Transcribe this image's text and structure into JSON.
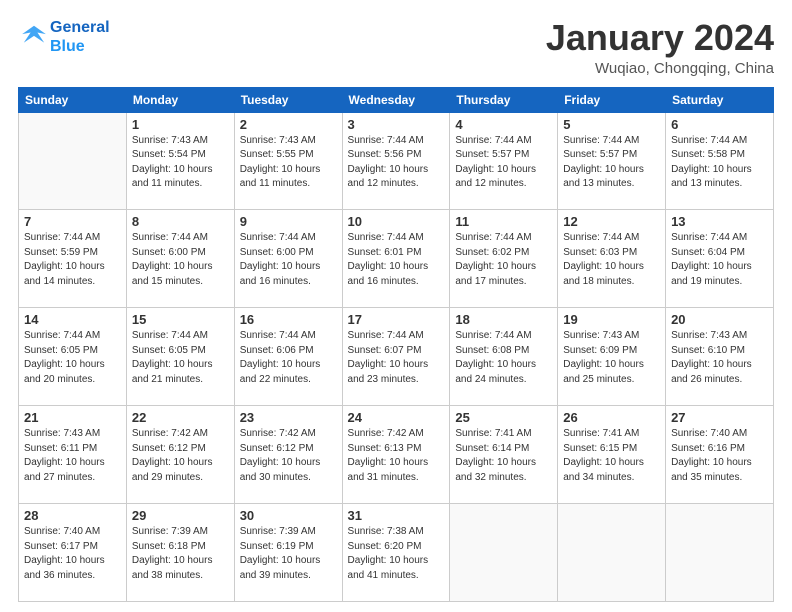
{
  "header": {
    "logo_line1": "General",
    "logo_line2": "Blue",
    "title": "January 2024",
    "location": "Wuqiao, Chongqing, China"
  },
  "weekdays": [
    "Sunday",
    "Monday",
    "Tuesday",
    "Wednesday",
    "Thursday",
    "Friday",
    "Saturday"
  ],
  "weeks": [
    [
      {
        "day": "",
        "sunrise": "",
        "sunset": "",
        "daylight": ""
      },
      {
        "day": "1",
        "sunrise": "Sunrise: 7:43 AM",
        "sunset": "Sunset: 5:54 PM",
        "daylight": "Daylight: 10 hours and 11 minutes."
      },
      {
        "day": "2",
        "sunrise": "Sunrise: 7:43 AM",
        "sunset": "Sunset: 5:55 PM",
        "daylight": "Daylight: 10 hours and 11 minutes."
      },
      {
        "day": "3",
        "sunrise": "Sunrise: 7:44 AM",
        "sunset": "Sunset: 5:56 PM",
        "daylight": "Daylight: 10 hours and 12 minutes."
      },
      {
        "day": "4",
        "sunrise": "Sunrise: 7:44 AM",
        "sunset": "Sunset: 5:57 PM",
        "daylight": "Daylight: 10 hours and 12 minutes."
      },
      {
        "day": "5",
        "sunrise": "Sunrise: 7:44 AM",
        "sunset": "Sunset: 5:57 PM",
        "daylight": "Daylight: 10 hours and 13 minutes."
      },
      {
        "day": "6",
        "sunrise": "Sunrise: 7:44 AM",
        "sunset": "Sunset: 5:58 PM",
        "daylight": "Daylight: 10 hours and 13 minutes."
      }
    ],
    [
      {
        "day": "7",
        "sunrise": "Sunrise: 7:44 AM",
        "sunset": "Sunset: 5:59 PM",
        "daylight": "Daylight: 10 hours and 14 minutes."
      },
      {
        "day": "8",
        "sunrise": "Sunrise: 7:44 AM",
        "sunset": "Sunset: 6:00 PM",
        "daylight": "Daylight: 10 hours and 15 minutes."
      },
      {
        "day": "9",
        "sunrise": "Sunrise: 7:44 AM",
        "sunset": "Sunset: 6:00 PM",
        "daylight": "Daylight: 10 hours and 16 minutes."
      },
      {
        "day": "10",
        "sunrise": "Sunrise: 7:44 AM",
        "sunset": "Sunset: 6:01 PM",
        "daylight": "Daylight: 10 hours and 16 minutes."
      },
      {
        "day": "11",
        "sunrise": "Sunrise: 7:44 AM",
        "sunset": "Sunset: 6:02 PM",
        "daylight": "Daylight: 10 hours and 17 minutes."
      },
      {
        "day": "12",
        "sunrise": "Sunrise: 7:44 AM",
        "sunset": "Sunset: 6:03 PM",
        "daylight": "Daylight: 10 hours and 18 minutes."
      },
      {
        "day": "13",
        "sunrise": "Sunrise: 7:44 AM",
        "sunset": "Sunset: 6:04 PM",
        "daylight": "Daylight: 10 hours and 19 minutes."
      }
    ],
    [
      {
        "day": "14",
        "sunrise": "Sunrise: 7:44 AM",
        "sunset": "Sunset: 6:05 PM",
        "daylight": "Daylight: 10 hours and 20 minutes."
      },
      {
        "day": "15",
        "sunrise": "Sunrise: 7:44 AM",
        "sunset": "Sunset: 6:05 PM",
        "daylight": "Daylight: 10 hours and 21 minutes."
      },
      {
        "day": "16",
        "sunrise": "Sunrise: 7:44 AM",
        "sunset": "Sunset: 6:06 PM",
        "daylight": "Daylight: 10 hours and 22 minutes."
      },
      {
        "day": "17",
        "sunrise": "Sunrise: 7:44 AM",
        "sunset": "Sunset: 6:07 PM",
        "daylight": "Daylight: 10 hours and 23 minutes."
      },
      {
        "day": "18",
        "sunrise": "Sunrise: 7:44 AM",
        "sunset": "Sunset: 6:08 PM",
        "daylight": "Daylight: 10 hours and 24 minutes."
      },
      {
        "day": "19",
        "sunrise": "Sunrise: 7:43 AM",
        "sunset": "Sunset: 6:09 PM",
        "daylight": "Daylight: 10 hours and 25 minutes."
      },
      {
        "day": "20",
        "sunrise": "Sunrise: 7:43 AM",
        "sunset": "Sunset: 6:10 PM",
        "daylight": "Daylight: 10 hours and 26 minutes."
      }
    ],
    [
      {
        "day": "21",
        "sunrise": "Sunrise: 7:43 AM",
        "sunset": "Sunset: 6:11 PM",
        "daylight": "Daylight: 10 hours and 27 minutes."
      },
      {
        "day": "22",
        "sunrise": "Sunrise: 7:42 AM",
        "sunset": "Sunset: 6:12 PM",
        "daylight": "Daylight: 10 hours and 29 minutes."
      },
      {
        "day": "23",
        "sunrise": "Sunrise: 7:42 AM",
        "sunset": "Sunset: 6:12 PM",
        "daylight": "Daylight: 10 hours and 30 minutes."
      },
      {
        "day": "24",
        "sunrise": "Sunrise: 7:42 AM",
        "sunset": "Sunset: 6:13 PM",
        "daylight": "Daylight: 10 hours and 31 minutes."
      },
      {
        "day": "25",
        "sunrise": "Sunrise: 7:41 AM",
        "sunset": "Sunset: 6:14 PM",
        "daylight": "Daylight: 10 hours and 32 minutes."
      },
      {
        "day": "26",
        "sunrise": "Sunrise: 7:41 AM",
        "sunset": "Sunset: 6:15 PM",
        "daylight": "Daylight: 10 hours and 34 minutes."
      },
      {
        "day": "27",
        "sunrise": "Sunrise: 7:40 AM",
        "sunset": "Sunset: 6:16 PM",
        "daylight": "Daylight: 10 hours and 35 minutes."
      }
    ],
    [
      {
        "day": "28",
        "sunrise": "Sunrise: 7:40 AM",
        "sunset": "Sunset: 6:17 PM",
        "daylight": "Daylight: 10 hours and 36 minutes."
      },
      {
        "day": "29",
        "sunrise": "Sunrise: 7:39 AM",
        "sunset": "Sunset: 6:18 PM",
        "daylight": "Daylight: 10 hours and 38 minutes."
      },
      {
        "day": "30",
        "sunrise": "Sunrise: 7:39 AM",
        "sunset": "Sunset: 6:19 PM",
        "daylight": "Daylight: 10 hours and 39 minutes."
      },
      {
        "day": "31",
        "sunrise": "Sunrise: 7:38 AM",
        "sunset": "Sunset: 6:20 PM",
        "daylight": "Daylight: 10 hours and 41 minutes."
      },
      {
        "day": "",
        "sunrise": "",
        "sunset": "",
        "daylight": ""
      },
      {
        "day": "",
        "sunrise": "",
        "sunset": "",
        "daylight": ""
      },
      {
        "day": "",
        "sunrise": "",
        "sunset": "",
        "daylight": ""
      }
    ]
  ]
}
